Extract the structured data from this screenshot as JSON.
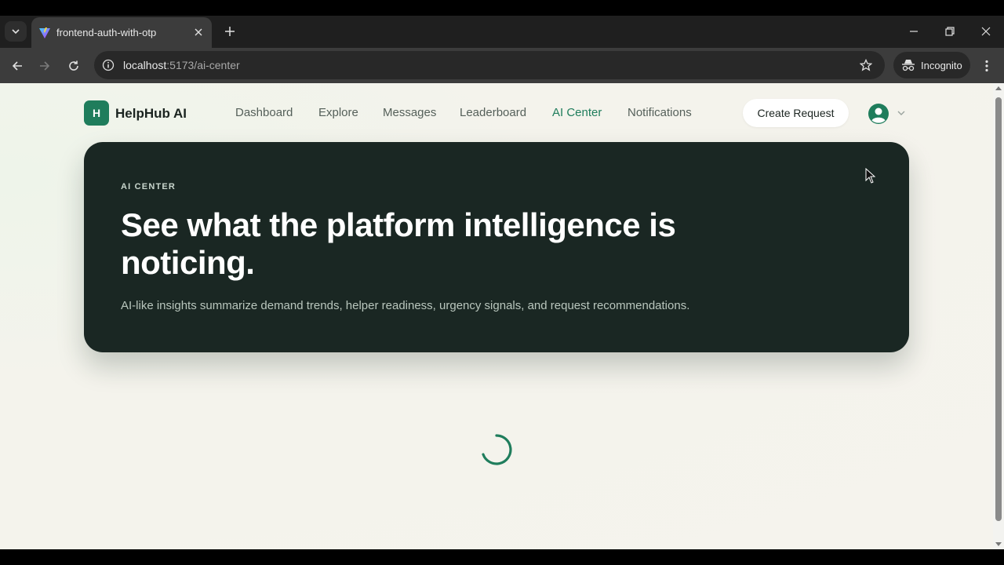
{
  "browser": {
    "tab": {
      "title": "frontend-auth-with-otp"
    },
    "address_bar": {
      "host": "localhost",
      "path": ":5173/ai-center"
    },
    "profile_label": "Incognito"
  },
  "app": {
    "logo_letter": "H",
    "brand": "HelpHub AI",
    "nav": [
      {
        "label": "Dashboard",
        "active": false
      },
      {
        "label": "Explore",
        "active": false
      },
      {
        "label": "Messages",
        "active": false
      },
      {
        "label": "Leaderboard",
        "active": false
      },
      {
        "label": "AI Center",
        "active": true
      },
      {
        "label": "Notifications",
        "active": false
      }
    ],
    "create_request_label": "Create Request"
  },
  "hero": {
    "eyebrow": "AI CENTER",
    "title": "See what the platform intelligence is noticing.",
    "subtitle": "AI-like insights summarize demand trends, helper readiness, urgency signals, and request recommendations."
  },
  "colors": {
    "accent": "#1f7d5c",
    "hero_bg": "#1a2723",
    "page_bg": "#f5f3ed"
  },
  "loading": {
    "icon": "spinner-icon"
  }
}
